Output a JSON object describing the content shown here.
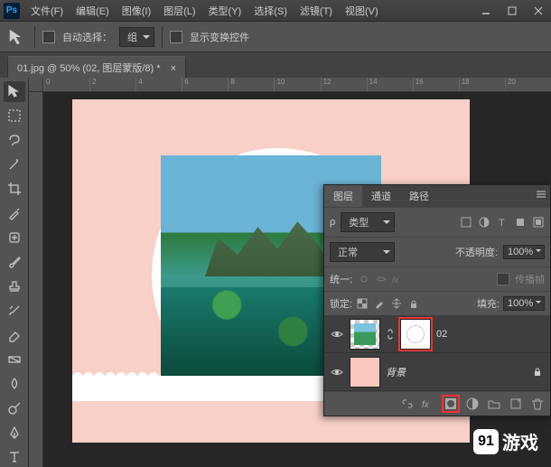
{
  "menu": {
    "file": "文件(F)",
    "edit": "编辑(E)",
    "image": "图像(I)",
    "layer": "图层(L)",
    "type": "类型(Y)",
    "select": "选择(S)",
    "filter": "滤镜(T)",
    "view": "视图(V)"
  },
  "options": {
    "auto_select": "自动选择：",
    "group": "组",
    "show_transform": "显示变换控件"
  },
  "doc_tab": "01.jpg @ 50% (02, 图层蒙版/8) *",
  "ruler_marks": [
    "0",
    "2",
    "4",
    "6",
    "8",
    "10",
    "12",
    "14",
    "16",
    "18",
    "20"
  ],
  "panels": {
    "tabs": {
      "layers": "图层",
      "channels": "通道",
      "paths": "路径"
    },
    "filter_kind": "类型",
    "blend_mode": "正常",
    "opacity_label": "不透明度:",
    "opacity_value": "100%",
    "unify_label": "统一:",
    "propagate": "传播帧",
    "lock_label": "锁定:",
    "fill_label": "填充:",
    "fill_value": "100%",
    "layers": [
      {
        "name": "02",
        "type": "masked"
      },
      {
        "name": "背景",
        "type": "bg"
      }
    ]
  },
  "watermark": {
    "badge": "91",
    "text": "游戏"
  }
}
